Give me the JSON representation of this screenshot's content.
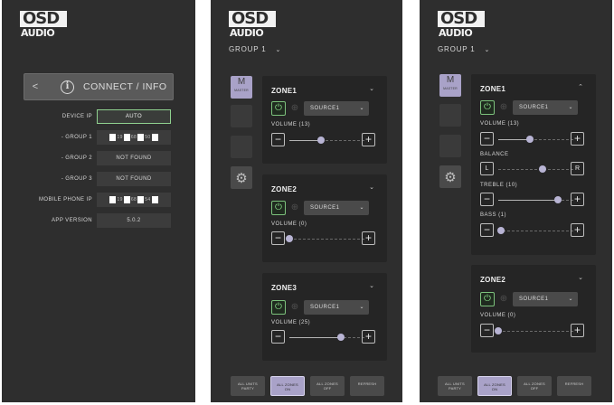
{
  "brand": {
    "logo_top": "OSD",
    "logo_bottom": "AUDIO"
  },
  "info_screen": {
    "connect_button": {
      "back": "<",
      "info_icon": "i",
      "label": "CONNECT / INFO"
    },
    "rows": [
      {
        "key": "DEVICE IP",
        "value": "AUTO",
        "style": "auto"
      },
      {
        "key": "- GROUP 1",
        "value": "",
        "style": "masked",
        "parts": [
          "19",
          "68",
          "50"
        ]
      },
      {
        "key": "- GROUP 2",
        "value": "NOT FOUND",
        "style": "plain"
      },
      {
        "key": "- GROUP 3",
        "value": "NOT FOUND",
        "style": "plain"
      },
      {
        "key": "MOBILE PHONE IP",
        "value": "",
        "style": "masked",
        "parts": [
          "19",
          "68",
          "54"
        ]
      },
      {
        "key": "APP VERSION",
        "value": "5.0.2",
        "style": "plain"
      }
    ]
  },
  "group_label": "GROUP 1",
  "master_button": {
    "big": "M",
    "small": "MASTER"
  },
  "screen2": {
    "zones": [
      {
        "name": "ZONE1",
        "source": "SOURCE1",
        "volume_label": "VOLUME (13)",
        "volume_fraction": 0.42
      },
      {
        "name": "ZONE2",
        "source": "SOURCE1",
        "volume_label": "VOLUME (0)",
        "volume_fraction": 0.0
      },
      {
        "name": "ZONE3",
        "source": "SOURCE1",
        "volume_label": "VOLUME (25)",
        "volume_fraction": 0.68
      }
    ]
  },
  "screen3": {
    "zone1": {
      "name": "ZONE1",
      "source": "SOURCE1",
      "volume_label": "VOLUME (13)",
      "volume_fraction": 0.42,
      "balance_label": "BALANCE",
      "balance_left": "L",
      "balance_right": "R",
      "balance_fraction": 0.58,
      "treble_label": "TREBLE (10)",
      "treble_fraction": 0.78,
      "bass_label": "BASS (1)",
      "bass_fraction": 0.04
    },
    "zone2": {
      "name": "ZONE2",
      "source": "SOURCE1",
      "volume_label": "VOLUME (0)",
      "volume_fraction": 0.0
    }
  },
  "bottom_buttons": [
    {
      "line1": "ALL UNITS",
      "line2": "PARTY"
    },
    {
      "line1": "ALL ZONES",
      "line2": "ON"
    },
    {
      "line1": "ALL ZONES",
      "line2": "OFF"
    },
    {
      "line1": "REFRESH",
      "line2": ""
    }
  ],
  "colors": {
    "bg": "#2e2e2e",
    "accent": "#a9a2c8",
    "power_green": "#7cc17c"
  }
}
